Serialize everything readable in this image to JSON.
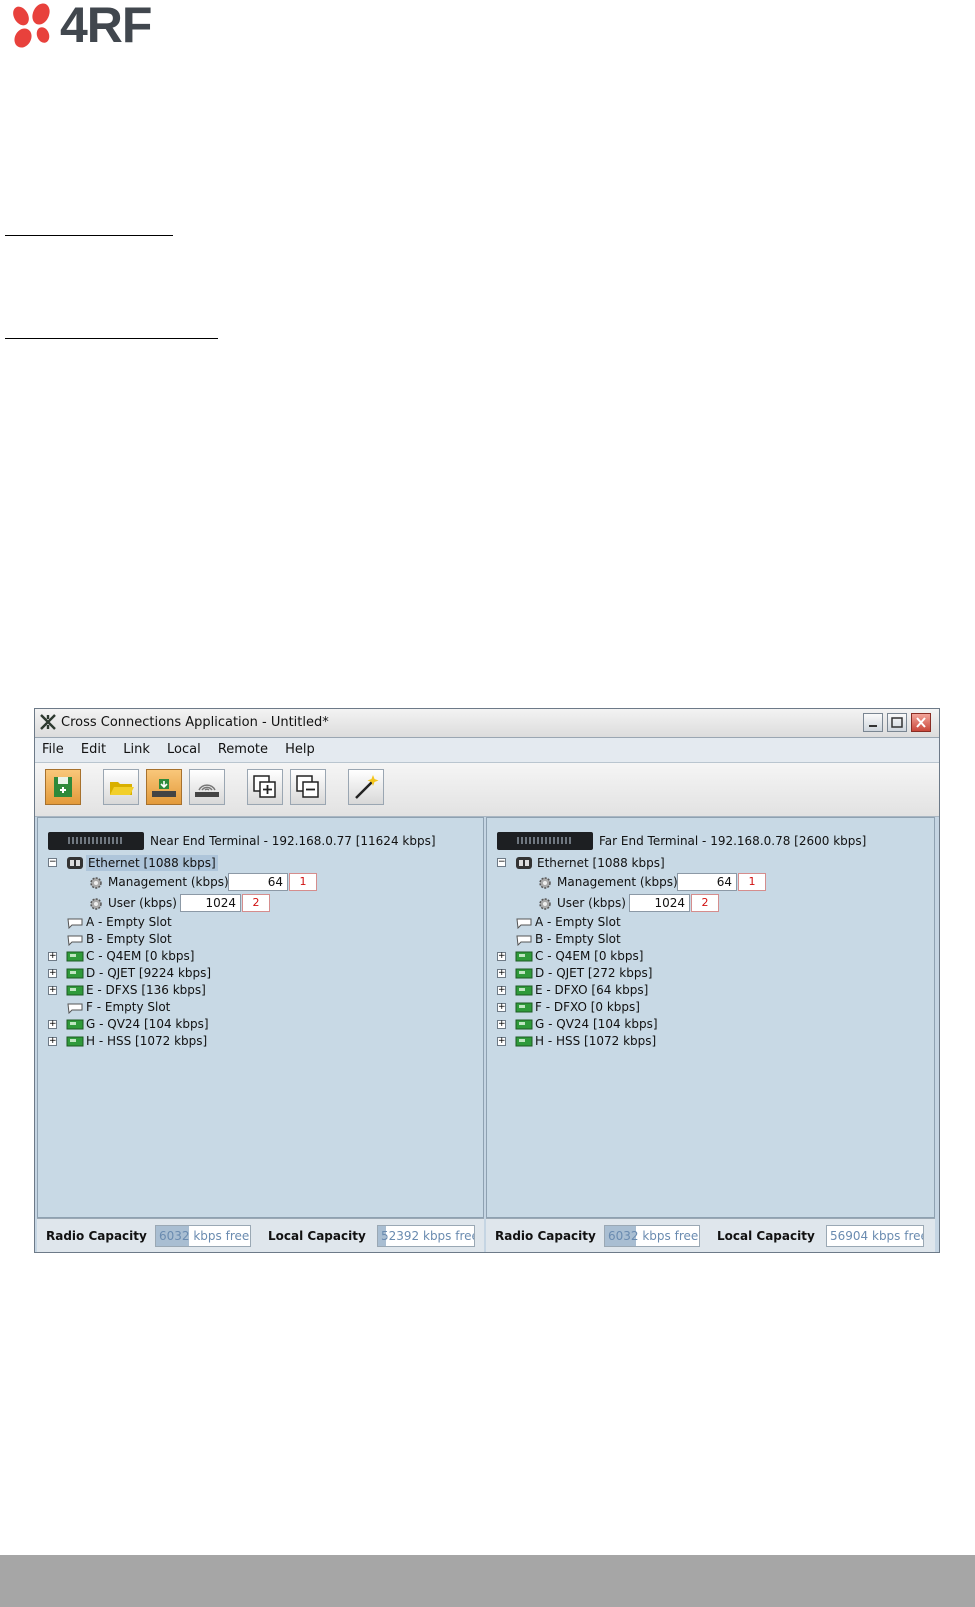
{
  "logo": {
    "text": "4RF"
  },
  "window": {
    "title": "Cross Connections Application - Untitled*",
    "menu": [
      "File",
      "Edit",
      "Link",
      "Local",
      "Remote",
      "Help"
    ],
    "toolbar": [
      {
        "name": "save-icon",
        "style": "orange"
      },
      {
        "name": "open-folder-icon",
        "style": "normal"
      },
      {
        "name": "send-local-icon",
        "style": "orange"
      },
      {
        "name": "send-remote-icon",
        "style": "normal"
      },
      {
        "name": "expand-all-icon",
        "style": "normal"
      },
      {
        "name": "collapse-all-icon",
        "style": "normal"
      },
      {
        "name": "wizard-wand-icon",
        "style": "normal"
      }
    ]
  },
  "near": {
    "terminal": "Near End Terminal - 192.168.0.77 [11624 kbps]",
    "ethernet": "Ethernet [1088 kbps]",
    "management_label": "Management (kbps)",
    "management_value": "64",
    "management_badge": "1",
    "user_label": "User (kbps)",
    "user_value": "1024",
    "user_badge": "2",
    "slots": [
      {
        "label": "A - Empty Slot",
        "empty": true
      },
      {
        "label": "B - Empty Slot",
        "empty": true
      },
      {
        "label": "C - Q4EM [0 kbps]",
        "empty": false
      },
      {
        "label": "D - QJET [9224 kbps]",
        "empty": false
      },
      {
        "label": "E - DFXS [136 kbps]",
        "empty": false
      },
      {
        "label": "F - Empty Slot",
        "empty": true
      },
      {
        "label": "G - QV24 [104 kbps]",
        "empty": false
      },
      {
        "label": "H - HSS [1072 kbps]",
        "empty": false
      }
    ],
    "radio_label": "Radio Capacity",
    "radio_value": "6032 kbps free",
    "radio_fill": 0.35,
    "local_label": "Local Capacity",
    "local_value": "52392 kbps free",
    "local_fill": 0.08
  },
  "far": {
    "terminal": "Far End Terminal - 192.168.0.78 [2600 kbps]",
    "ethernet": "Ethernet [1088 kbps]",
    "management_label": "Management (kbps)",
    "management_value": "64",
    "management_badge": "1",
    "user_label": "User (kbps)",
    "user_value": "1024",
    "user_badge": "2",
    "slots": [
      {
        "label": "A - Empty Slot",
        "empty": true
      },
      {
        "label": "B - Empty Slot",
        "empty": true
      },
      {
        "label": "C - Q4EM [0 kbps]",
        "empty": false
      },
      {
        "label": "D - QJET [272 kbps]",
        "empty": false
      },
      {
        "label": "E - DFXO [64 kbps]",
        "empty": false
      },
      {
        "label": "F - DFXO [0 kbps]",
        "empty": false
      },
      {
        "label": "G - QV24 [104 kbps]",
        "empty": false
      },
      {
        "label": "H - HSS [1072 kbps]",
        "empty": false
      }
    ],
    "radio_label": "Radio Capacity",
    "radio_value": "6032 kbps free",
    "radio_fill": 0.33,
    "local_label": "Local Capacity",
    "local_value": "56904 kbps free",
    "local_fill": 0.0
  }
}
